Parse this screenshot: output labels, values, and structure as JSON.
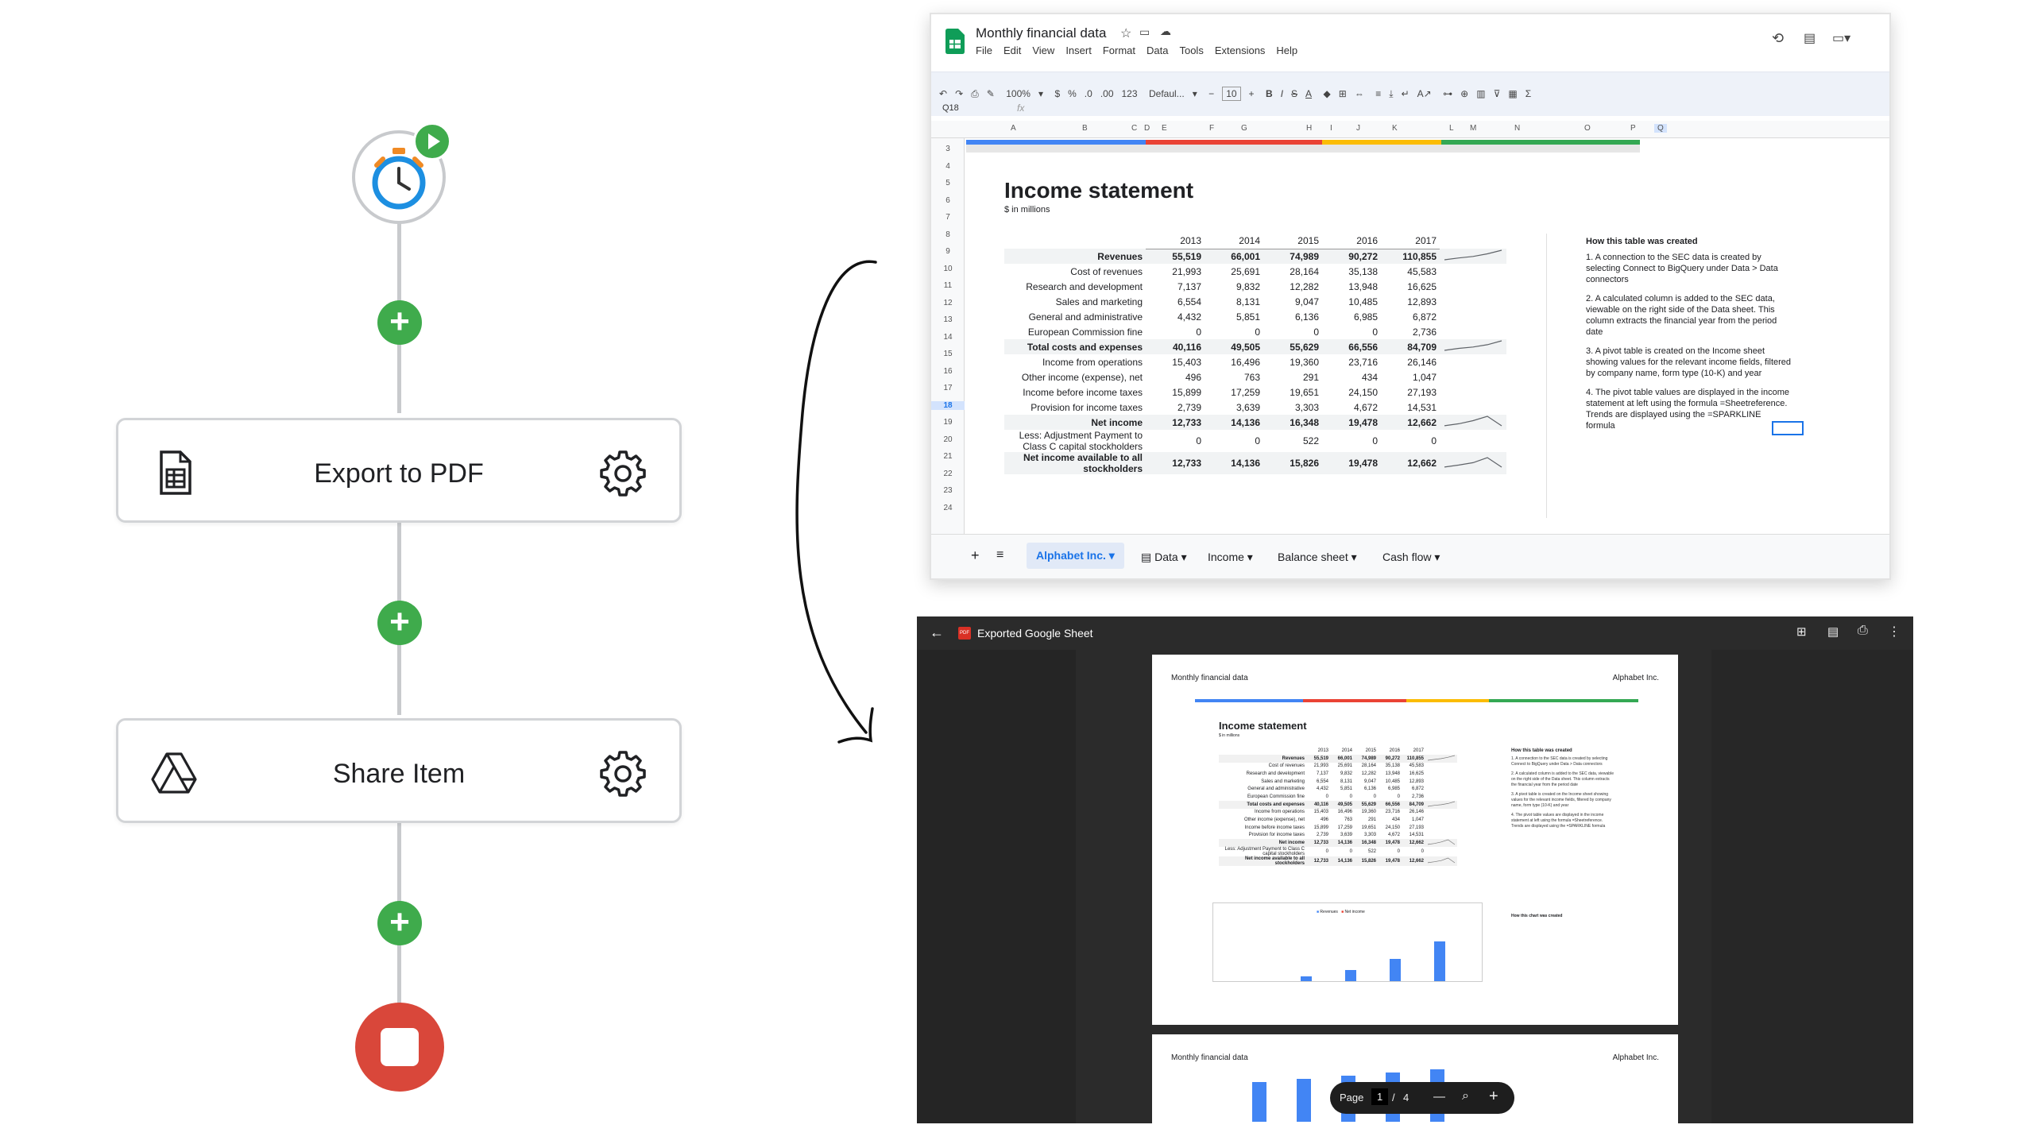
{
  "flow": {
    "plus": "+",
    "steps": [
      {
        "label": "Export to PDF",
        "icon": "spreadsheet-icon"
      },
      {
        "label": "Share Item",
        "icon": "google-drive-icon"
      }
    ],
    "colors": {
      "green": "#3fab4c",
      "stop": "#d9473a",
      "timer_blue": "#1d8fe1"
    }
  },
  "sheets": {
    "title": "Monthly financial data",
    "menu": [
      "File",
      "Edit",
      "View",
      "Insert",
      "Format",
      "Data",
      "Tools",
      "Extensions",
      "Help"
    ],
    "toolbar": {
      "zoom": "100%",
      "currency": "$",
      "percent": "%",
      "dec_minus": ".0",
      "dec_plus": ".00",
      "num": "123",
      "font": "Defaul...",
      "font_size": "10"
    },
    "cell_ref": "Q18",
    "fx": "fx",
    "columns": [
      "A",
      "B",
      "C",
      "D",
      "E",
      "F",
      "G",
      "H",
      "I",
      "J",
      "K",
      "L",
      "M",
      "N",
      "O",
      "P",
      "Q"
    ],
    "row_numbers": [
      "3",
      "4",
      "5",
      "6",
      "7",
      "8",
      "9",
      "10",
      "11",
      "12",
      "13",
      "14",
      "15",
      "16",
      "17",
      "18",
      "19",
      "20",
      "21",
      "22",
      "23",
      "24"
    ],
    "statement": {
      "title": "Income statement",
      "subtitle": "$ in millions",
      "years": [
        "2013",
        "2014",
        "2015",
        "2016",
        "2017"
      ],
      "rows": [
        {
          "label": "Revenues",
          "bold": true,
          "values": [
            "55,519",
            "66,001",
            "74,989",
            "90,272",
            "110,855"
          ],
          "spark": true
        },
        {
          "label": "Cost of revenues",
          "values": [
            "21,993",
            "25,691",
            "28,164",
            "35,138",
            "45,583"
          ]
        },
        {
          "label": "Research and development",
          "values": [
            "7,137",
            "9,832",
            "12,282",
            "13,948",
            "16,625"
          ]
        },
        {
          "label": "Sales and marketing",
          "values": [
            "6,554",
            "8,131",
            "9,047",
            "10,485",
            "12,893"
          ]
        },
        {
          "label": "General and administrative",
          "values": [
            "4,432",
            "5,851",
            "6,136",
            "6,985",
            "6,872"
          ]
        },
        {
          "label": "European Commission fine",
          "values": [
            "0",
            "0",
            "0",
            "0",
            "2,736"
          ]
        },
        {
          "label": "Total costs and expenses",
          "bold": true,
          "values": [
            "40,116",
            "49,505",
            "55,629",
            "66,556",
            "84,709"
          ],
          "spark": true
        },
        {
          "label": "Income from operations",
          "values": [
            "15,403",
            "16,496",
            "19,360",
            "23,716",
            "26,146"
          ]
        },
        {
          "label": "Other income (expense), net",
          "values": [
            "496",
            "763",
            "291",
            "434",
            "1,047"
          ]
        },
        {
          "label": "Income before income taxes",
          "values": [
            "15,899",
            "17,259",
            "19,651",
            "24,150",
            "27,193"
          ]
        },
        {
          "label": "Provision for income taxes",
          "values": [
            "2,739",
            "3,639",
            "3,303",
            "4,672",
            "14,531"
          ]
        },
        {
          "label": "Net income",
          "bold": true,
          "values": [
            "12,733",
            "14,136",
            "16,348",
            "19,478",
            "12,662"
          ],
          "spark": true
        },
        {
          "label": "Less: Adjustment Payment to Class C capital stockholders",
          "values": [
            "0",
            "0",
            "522",
            "0",
            "0"
          ]
        },
        {
          "label": "Net income available to all stockholders",
          "bold": true,
          "values": [
            "12,733",
            "14,136",
            "15,826",
            "19,478",
            "12,662"
          ],
          "spark": true
        }
      ]
    },
    "notes": {
      "title": "How this table was created",
      "items": [
        "1. A connection to the SEC data is created by selecting Connect to BigQuery under Data > Data connectors",
        "2. A calculated column is added to the SEC data, viewable on the right side of the Data sheet. This column extracts the financial year from the period date",
        "3. A pivot table is created on the Income sheet showing values for the relevant income fields, filtered by company name, form type (10-K) and year",
        "4. The pivot table values are displayed in the income statement at left using the formula =Sheetreference. Trends are displayed using the =SPARKLINE formula"
      ]
    },
    "tabs": [
      "Alphabet Inc.",
      "Data",
      "Income",
      "Balance sheet",
      "Cash flow"
    ],
    "active_tab": "Alphabet Inc."
  },
  "drive": {
    "file_title": "Exported Google Sheet",
    "pdf_badge": "PDF",
    "page_header_left": "Monthly financial data",
    "page_header_right": "Alphabet Inc.",
    "mini_title": "Income statement",
    "mini_subtitle": "$ in millions",
    "mini_notes_title": "How this table was created",
    "chart_legend": [
      "Revenues",
      "Net income"
    ],
    "chart_notes_title": "How this chart was created",
    "controls": {
      "page_label": "Page",
      "page": "1",
      "sep": "/",
      "total": "4",
      "minus": "—",
      "plus": "+"
    }
  }
}
